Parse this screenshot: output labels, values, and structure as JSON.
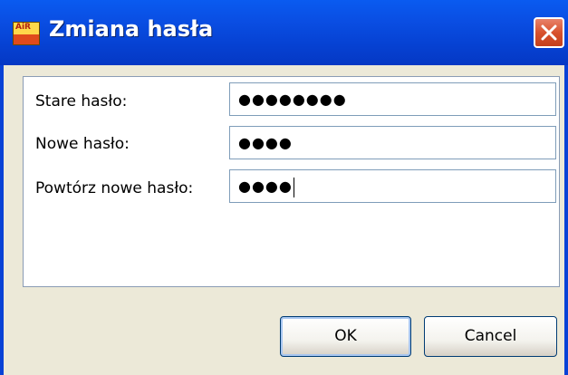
{
  "window": {
    "title": "Zmiana hasła",
    "icon_label": "AiR"
  },
  "form": {
    "fields": [
      {
        "label": "Stare hasło:",
        "value": "●●●●●●●●"
      },
      {
        "label": "Nowe hasło:",
        "value": "●●●●"
      },
      {
        "label": "Powtórz nowe hasło:",
        "value": "●●●●"
      }
    ]
  },
  "buttons": {
    "ok_label": "OK",
    "cancel_label": "Cancel"
  },
  "colors": {
    "titlebar": "#0a4fe4",
    "close": "#d8522e",
    "dialog_bg": "#ece9d8"
  }
}
